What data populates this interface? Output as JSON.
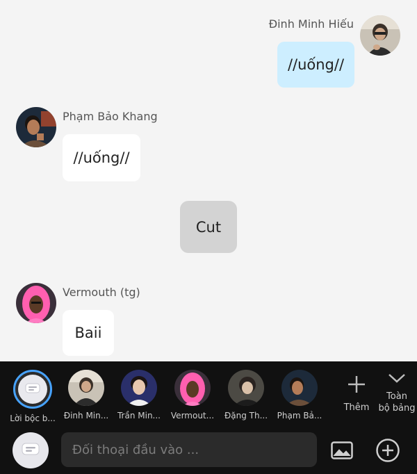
{
  "messages": [
    {
      "sender": "Đinh Minh Hiếu",
      "text": "//uống//"
    },
    {
      "sender": "Phạm Bảo Khang",
      "text": "//uống//"
    },
    {
      "system_text": "Cut"
    },
    {
      "sender": "Vermouth (tg)",
      "text": "Baii"
    }
  ],
  "characters": [
    {
      "label": "Lời bộc b..."
    },
    {
      "label": "Đinh Min..."
    },
    {
      "label": "Trần Min..."
    },
    {
      "label": "Vermout..."
    },
    {
      "label": "Đặng Th..."
    },
    {
      "label": "Phạm Bả..."
    }
  ],
  "controls": {
    "add_label": "Thêm",
    "expand_label_line1": "Toàn",
    "expand_label_line2": "bộ bảng"
  },
  "input": {
    "placeholder": "Đối thoại đầu vào ..."
  },
  "colors": {
    "mine_bubble": "#cdeeff",
    "other_bubble": "#ffffff",
    "system_bubble": "#d3d3d3",
    "selected_ring": "#47a3ff",
    "bottom_bar": "#111111"
  }
}
